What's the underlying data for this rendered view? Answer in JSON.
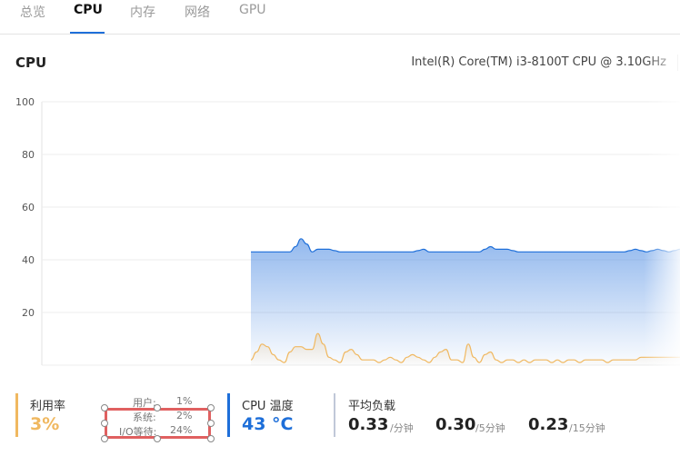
{
  "tabs": [
    {
      "label": "总览"
    },
    {
      "label": "CPU"
    },
    {
      "label": "内存"
    },
    {
      "label": "网络"
    },
    {
      "label": "GPU"
    }
  ],
  "active_tab": "CPU",
  "section_title": "CPU",
  "cpu_model": "Intel(R) Core(TM) i3-8100T CPU @ 3.10GHz",
  "chart_data": {
    "type": "area",
    "ylim": [
      0,
      100
    ],
    "yticks": [
      20,
      40,
      60,
      80,
      100
    ],
    "grid": true,
    "series": [
      {
        "color": "#1e6fd9",
        "values": [
          43,
          43,
          43,
          43,
          43,
          43,
          43,
          43,
          45,
          48,
          46,
          43,
          44,
          44,
          44,
          43.5,
          43,
          43,
          43,
          43,
          43,
          43,
          43,
          43,
          43,
          43,
          43,
          43,
          43,
          43,
          43.5,
          44,
          43,
          43,
          43,
          43,
          43,
          43,
          43,
          43,
          43,
          43,
          44,
          45,
          44,
          44,
          44,
          43.5,
          43,
          43,
          43,
          43,
          43,
          43,
          43,
          43,
          43,
          43,
          43,
          43,
          43,
          43,
          43,
          43,
          43,
          43,
          43,
          43,
          43.5,
          44,
          43.5,
          43,
          43.5,
          44,
          43.5,
          43,
          43.5,
          44
        ]
      },
      {
        "color": "#f0b860",
        "values": [
          2,
          5,
          8,
          7,
          4,
          2,
          1,
          5,
          7,
          7,
          6,
          6,
          12,
          8,
          3,
          2,
          1,
          5,
          6,
          4,
          2,
          2,
          2,
          1,
          2,
          3,
          2,
          1,
          3,
          4,
          3,
          2,
          1,
          3,
          5,
          6,
          2,
          2,
          1,
          8,
          3,
          1,
          4,
          5,
          2,
          1,
          2,
          2,
          1,
          2,
          1,
          2,
          2,
          2,
          1,
          2,
          1,
          2,
          2,
          1,
          2,
          2,
          2,
          2,
          1,
          2,
          2,
          2,
          2,
          2,
          3,
          3,
          3,
          3,
          3,
          3,
          3,
          3
        ]
      }
    ]
  },
  "usage": {
    "label": "利用率",
    "value": "3%",
    "user_label": "用户:",
    "user_value": "1%",
    "system_label": "系统:",
    "system_value": "2%",
    "io_label": "I/O等待:",
    "io_value": "24%",
    "accent": "#f0b860"
  },
  "temperature": {
    "label": "CPU 温度",
    "value": "43 °C",
    "accent": "#1e6fd9"
  },
  "load": {
    "label": "平均负载",
    "accent": "#c0c8d8",
    "items": [
      {
        "value": "0.33",
        "unit": "/分钟"
      },
      {
        "value": "0.30",
        "unit": "/5分钟"
      },
      {
        "value": "0.23",
        "unit": "/15分钟"
      }
    ]
  }
}
